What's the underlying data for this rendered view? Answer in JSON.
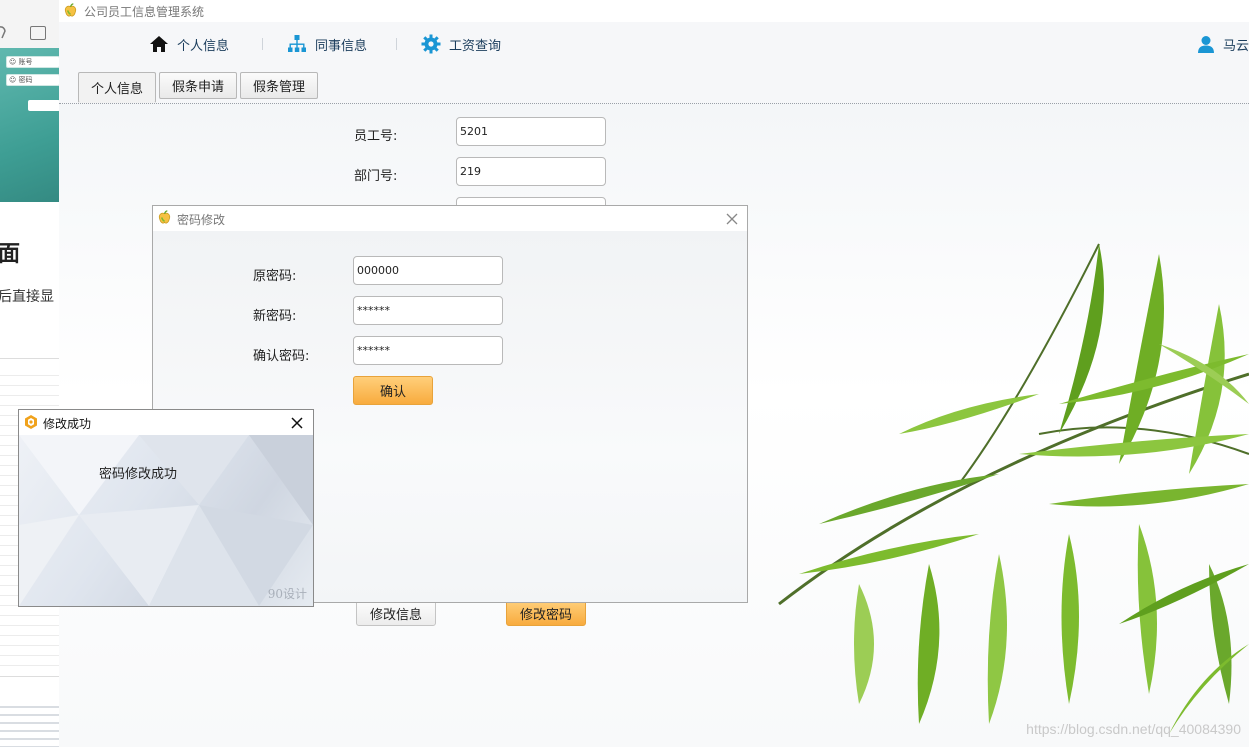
{
  "app": {
    "title": "公司员工信息管理系统"
  },
  "nav": {
    "items": [
      {
        "label": "个人信息",
        "icon": "home-icon"
      },
      {
        "label": "同事信息",
        "icon": "org-chart-icon"
      },
      {
        "label": "工资查询",
        "icon": "gear-icon"
      }
    ],
    "user": {
      "name": "马云",
      "icon": "user-icon"
    }
  },
  "tabs": [
    {
      "label": "个人信息",
      "active": true
    },
    {
      "label": "假条申请",
      "active": false
    },
    {
      "label": "假条管理",
      "active": false
    }
  ],
  "profile_form": {
    "employee_id": {
      "label": "员工号:",
      "value": "5201"
    },
    "department_id": {
      "label": "部门号:",
      "value": "219"
    },
    "edit_info_button": "修改信息",
    "change_password_button": "修改密码"
  },
  "password_dialog": {
    "title": "密码修改",
    "old_password": {
      "label": "原密码:",
      "value": "000000"
    },
    "new_password": {
      "label": "新密码:",
      "value": "******"
    },
    "confirm_password": {
      "label": "确认密码:",
      "value": "******"
    },
    "confirm_button": "确认"
  },
  "success_dialog": {
    "title": "修改成功",
    "message": "密码修改成功",
    "brand": "90设计"
  },
  "background_window": {
    "fields": [
      "账号",
      "密码"
    ],
    "heading": "面",
    "subtext": "后直接显"
  },
  "watermark": "https://blog.csdn.net/qq_40084390",
  "colors": {
    "accent_orange": "#f8ab3e",
    "nav_text": "#1b3d5c",
    "icon_blue": "#1a96d4",
    "bamboo_green": "#7dbb2e"
  }
}
